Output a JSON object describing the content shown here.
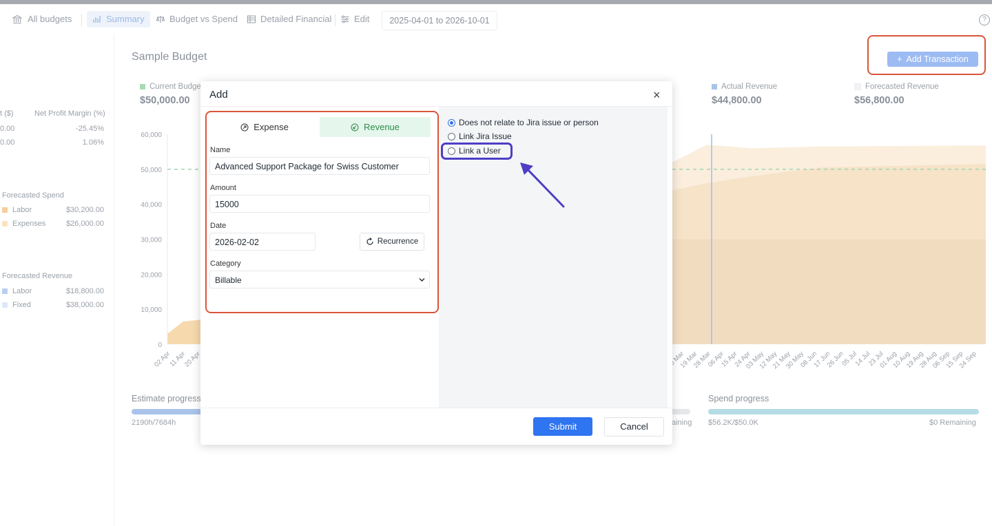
{
  "nav": {
    "all_budgets": "All budgets",
    "summary": "Summary",
    "budget_vs_spend": "Budget vs Spend",
    "detailed_financial": "Detailed Financial",
    "edit": "Edit",
    "date_range": "2025-04-01 to 2026-10-01",
    "help": "?"
  },
  "page": {
    "title": "Sample Budget",
    "add_transaction": "Add Transaction"
  },
  "metrics": [
    {
      "label": "Current Budget",
      "value": "$50,000.00",
      "color": "#a8dbb3"
    },
    {
      "label": "Actual Revenue",
      "value": "$44,800.00",
      "color": "#a9c4ea"
    },
    {
      "label": "Forecasted Revenue",
      "value": "$56,800.00",
      "color": "#f1f3f6"
    }
  ],
  "left_panel": {
    "col_a": "t ($)",
    "col_b": "Net Profit Margin (%)",
    "rows": [
      {
        "a": "0.00",
        "b": "-25.45%"
      },
      {
        "a": "0.00",
        "b": "1.06%"
      }
    ],
    "forecasted_spend": {
      "title": "Forecasted Spend",
      "items": [
        {
          "label": "Labor",
          "value": "$30,200.00",
          "color": "#f5cf9b"
        },
        {
          "label": "Expenses",
          "value": "$26,000.00",
          "color": "#fae3c4"
        }
      ]
    },
    "forecasted_revenue": {
      "title": "Forecasted Revenue",
      "items": [
        {
          "label": "Labor",
          "value": "$18,800.00",
          "color": "#b9cff1"
        },
        {
          "label": "Fixed",
          "value": "$38,000.00",
          "color": "#dbe8f8"
        }
      ]
    }
  },
  "chart_data": {
    "type": "area",
    "yticks": [
      "60,000",
      "50,000",
      "40,000",
      "30,000",
      "20,000",
      "10,000",
      "0"
    ],
    "ylim": [
      0,
      60000
    ],
    "budget_line": 50000,
    "xticks_left": [
      "02 Apr",
      "11 Apr",
      "20 Apr"
    ],
    "xticks_right": [
      "10 Mar",
      "19 Mar",
      "28 Mar",
      "06 Apr",
      "15 Apr",
      "24 Apr",
      "03 May",
      "12 May",
      "21 May",
      "30 May",
      "08 Jun",
      "17 Jun",
      "26 Jun",
      "05 Jul",
      "14 Jul",
      "23 Jul",
      "01 Aug",
      "10 Aug",
      "19 Aug",
      "28 Aug",
      "06 Sep",
      "15 Sep",
      "24 Sep"
    ]
  },
  "progress": {
    "estimate": {
      "label": "Estimate progress",
      "sub": "2190h/7684h",
      "fraction": 0.285
    },
    "spend": {
      "label": "Spend progress",
      "sub_left": "$56.2K/$50.0K",
      "sub_right": "$0 Remaining",
      "fraction": 1.0
    },
    "middle_sub": "aining"
  },
  "modal": {
    "title": "Add",
    "close": "×",
    "tabs": [
      {
        "label": "Expense",
        "active": false
      },
      {
        "label": "Revenue",
        "active": true
      }
    ],
    "name_label": "Name",
    "name_value": "Advanced Support Package for Swiss Customer",
    "amount_label": "Amount",
    "amount_value": "15000",
    "date_label": "Date",
    "date_value": "2026-02-02",
    "recurrence": "Recurrence",
    "category_label": "Category",
    "category_value": "Billable",
    "radios": [
      {
        "label": "Does not relate to Jira issue or person",
        "checked": true
      },
      {
        "label": "Link Jira Issue",
        "checked": false
      },
      {
        "label": "Link a User",
        "checked": false
      }
    ],
    "submit": "Submit",
    "cancel": "Cancel"
  }
}
